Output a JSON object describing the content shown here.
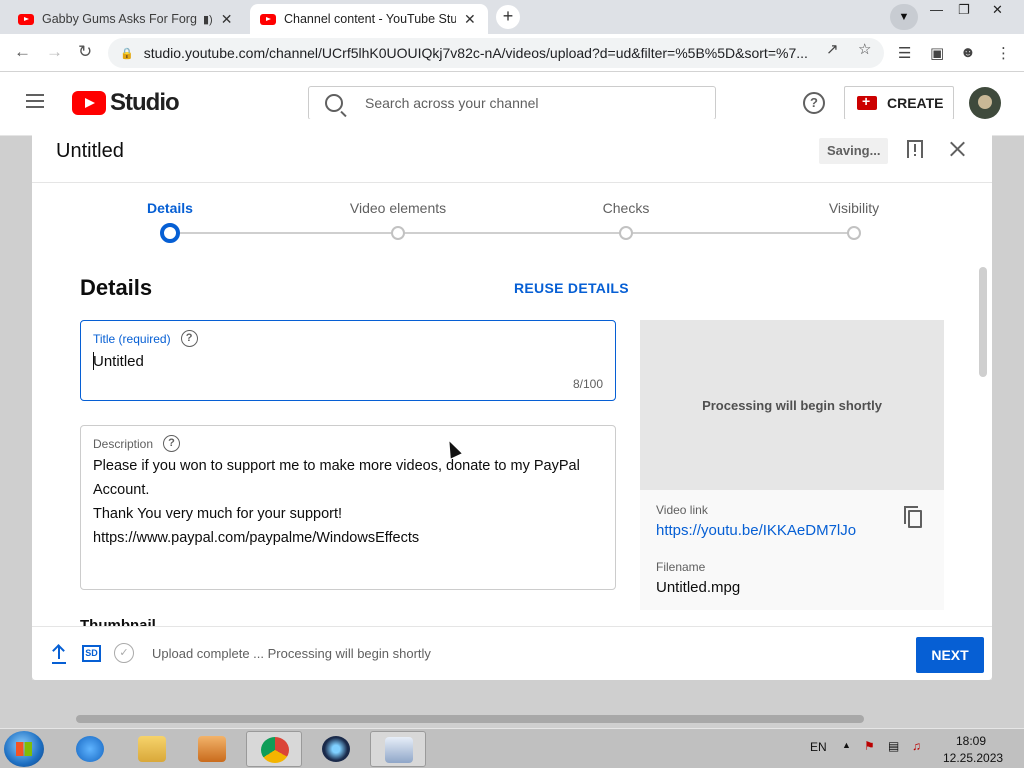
{
  "browser": {
    "tabs": [
      {
        "title": "Gabby Gums Asks For Forgiv",
        "active": false
      },
      {
        "title": "Channel content - YouTube Studio",
        "active": true
      }
    ],
    "url": "studio.youtube.com/channel/UCrf5lhK0UOUIQkj7v82c-nA/videos/upload?d=ud&filter=%5B%5D&sort=%7..."
  },
  "studio": {
    "logo_text": "Studio",
    "search_placeholder": "Search across your channel",
    "create_label": "CREATE"
  },
  "modal": {
    "title": "Untitled",
    "saving_label": "Saving...",
    "steps": [
      {
        "label": "Details",
        "active": true
      },
      {
        "label": "Video elements",
        "active": false
      },
      {
        "label": "Checks",
        "active": false
      },
      {
        "label": "Visibility",
        "active": false
      }
    ],
    "section_heading": "Details",
    "reuse_label": "REUSE DETAILS",
    "title_field": {
      "label": "Title (required)",
      "value": "Untitled",
      "counter": "8/100"
    },
    "description_field": {
      "label": "Description",
      "lines": [
        "Please if you won to support me to make more videos, donate to my PayPal Account.",
        "Thank You very much for your support!",
        "https://www.paypal.com/paypalme/WindowsEffects"
      ]
    },
    "thumbnail_heading": "Thumbnail",
    "preview": {
      "processing_text": "Processing will begin shortly",
      "video_link_label": "Video link",
      "video_link": "https://youtu.be/IKKAeDM7lJo",
      "filename_label": "Filename",
      "filename": "Untitled.mpg"
    },
    "footer": {
      "sd_badge": "SD",
      "status": "Upload complete ... Processing will begin shortly",
      "next_label": "NEXT"
    }
  },
  "taskbar": {
    "language": "EN",
    "time": "18:09",
    "date": "12.25.2023"
  },
  "colors": {
    "accent": "#065fd4",
    "brand": "#ff0000"
  }
}
